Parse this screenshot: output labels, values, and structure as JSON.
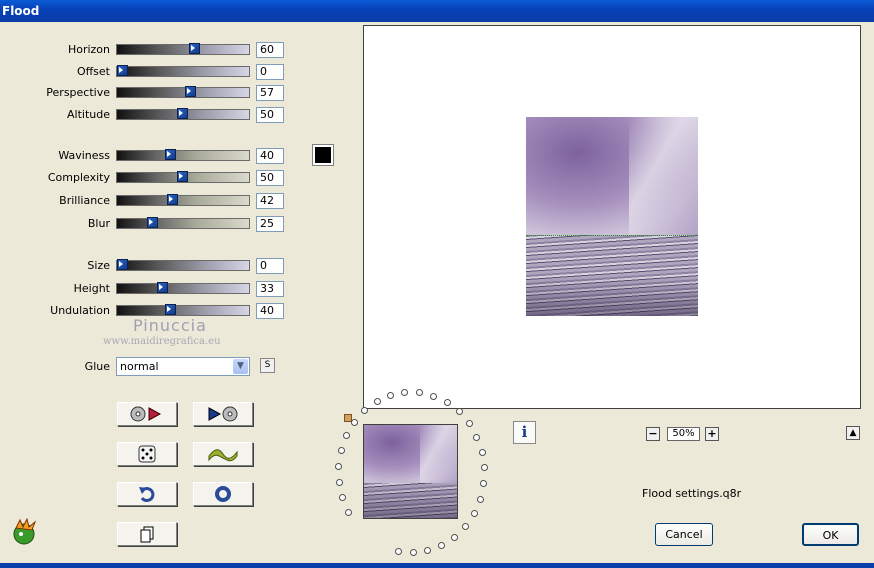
{
  "window": {
    "title": "Flood"
  },
  "sliders_group1": [
    {
      "label": "Horizon",
      "value": "60",
      "fill": 0.6
    },
    {
      "label": "Offset",
      "value": "0",
      "fill": 0.0
    },
    {
      "label": "Perspective",
      "value": "57",
      "fill": 0.57
    },
    {
      "label": "Altitude",
      "value": "50",
      "fill": 0.5
    }
  ],
  "sliders_group2": [
    {
      "label": "Waviness",
      "value": "40",
      "fill": 0.4
    },
    {
      "label": "Complexity",
      "value": "50",
      "fill": 0.5
    },
    {
      "label": "Brilliance",
      "value": "42",
      "fill": 0.42
    },
    {
      "label": "Blur",
      "value": "25",
      "fill": 0.25
    }
  ],
  "sliders_group3": [
    {
      "label": "Size",
      "value": "0",
      "fill": 0.0
    },
    {
      "label": "Height",
      "value": "33",
      "fill": 0.33
    },
    {
      "label": "Undulation",
      "value": "40",
      "fill": 0.4
    }
  ],
  "color_swatch": "#000000",
  "watermark": {
    "name": "Pinuccia",
    "url": "www.maidiregrafica.eu"
  },
  "glue": {
    "label": "Glue",
    "selected": "normal",
    "lock_label": "S"
  },
  "tool_buttons": [
    "load-preset-icon",
    "play-preset-icon",
    "randomize-dice-icon",
    "wave-icon",
    "undo-icon",
    "reset-icon",
    "copy-icon"
  ],
  "zoom": {
    "value": "50%"
  },
  "preset_file": "Flood settings.q8r",
  "buttons": {
    "cancel": "Cancel",
    "ok": "OK"
  }
}
